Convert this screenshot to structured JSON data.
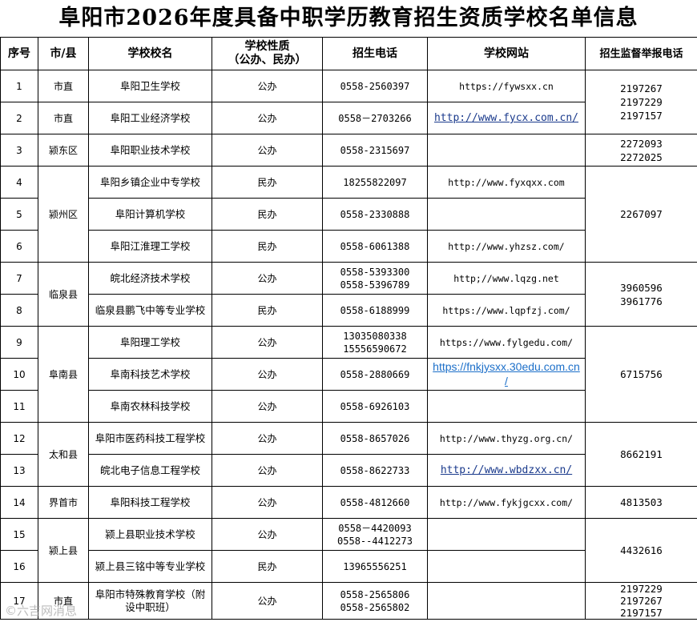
{
  "title": "阜阳市2026年度具备中职学历教育招生资质学校名单信息",
  "headers": {
    "seq": "序号",
    "city": "市/县",
    "school": "学校校名",
    "nature_line1": "学校性质",
    "nature_line2": "（公办、民办）",
    "phone": "招生电话",
    "website": "学校网站",
    "report": "招生监督举报电话"
  },
  "rows": [
    {
      "seq": "1",
      "city": "市直",
      "school": "阜阳卫生学校",
      "nature": "公办",
      "phone": "0558-2560397",
      "website": "https://fywsxx.cn"
    },
    {
      "seq": "2",
      "city": "市直",
      "school": "阜阳工业经济学校",
      "nature": "公办",
      "phone": "0558－2703266",
      "website": "http://www.fycx.com.cn/"
    },
    {
      "seq": "3",
      "city": "颍东区",
      "school": "阜阳职业技术学校",
      "nature": "公办",
      "phone": "0558-2315697",
      "website": ""
    },
    {
      "seq": "4",
      "city": "颍州区",
      "school": "阜阳乡镇企业中专学校",
      "nature": "民办",
      "phone": "18255822097",
      "website": "http://www.fyxqxx.com"
    },
    {
      "seq": "5",
      "city": "",
      "school": "阜阳计算机学校",
      "nature": "民办",
      "phone": "0558-2330888",
      "website": ""
    },
    {
      "seq": "6",
      "city": "",
      "school": "阜阳江淮理工学校",
      "nature": "民办",
      "phone": "0558-6061388",
      "website": "http://www.yhzsz.com/"
    },
    {
      "seq": "7",
      "city": "临泉县",
      "school": "皖北经济技术学校",
      "nature": "公办",
      "phone_line1": "0558-5393300",
      "phone_line2": "0558-5396789",
      "website": "http;//www.lqzg.net"
    },
    {
      "seq": "8",
      "city": "",
      "school": "临泉县鹏飞中等专业学校",
      "nature": "民办",
      "phone": "0558-6188999",
      "website": "https://www.lqpfzj.com/"
    },
    {
      "seq": "9",
      "city": "阜南县",
      "school": "阜阳理工学校",
      "nature": "公办",
      "phone_line1": "13035080338",
      "phone_line2": "15556590672",
      "website": "https://www.fylgedu.com/"
    },
    {
      "seq": "10",
      "city": "",
      "school": "阜南科技艺术学校",
      "nature": "公办",
      "phone": "0558-2880669",
      "website_line1": "https://fnkjysxx.30edu.com.cn",
      "website_line2": "/"
    },
    {
      "seq": "11",
      "city": "",
      "school": "阜南农林科技学校",
      "nature": "公办",
      "phone": "0558-6926103",
      "website": ""
    },
    {
      "seq": "12",
      "city": "太和县",
      "school": "阜阳市医药科技工程学校",
      "nature": "公办",
      "phone": "0558-8657026",
      "website": "http://www.thyzg.org.cn/"
    },
    {
      "seq": "13",
      "city": "",
      "school": "皖北电子信息工程学校",
      "nature": "公办",
      "phone": "0558-8622733",
      "website": "http://www.wbdzxx.cn/"
    },
    {
      "seq": "14",
      "city": "界首市",
      "school": "阜阳科技工程学校",
      "nature": "公办",
      "phone": "0558-4812660",
      "website": "http://www.fykjgcxx.com/"
    },
    {
      "seq": "15",
      "city": "颍上县",
      "school": "颍上县职业技术学校",
      "nature": "公办",
      "phone_line1": "0558－4420093",
      "phone_line2": "0558--4412273",
      "website": ""
    },
    {
      "seq": "16",
      "city": "",
      "school": "颍上县三铭中等专业学校",
      "nature": "民办",
      "phone": "13965556251",
      "website": ""
    },
    {
      "seq": "17",
      "city": "市直",
      "school_line1": "阜阳市特殊教育学校（附",
      "school_line2": "设中职班）",
      "nature": "公办",
      "phone_line1": "0558-2565806",
      "phone_line2": "0558-2565802",
      "website": ""
    }
  ],
  "report_phones": {
    "g1": [
      "2197267",
      "2197229",
      "2197157"
    ],
    "g2": [
      "2272093",
      "2272025"
    ],
    "g3": [
      "2267097"
    ],
    "g4": [
      "3960596",
      "3961776"
    ],
    "g5": [
      "6715756"
    ],
    "g6": [
      "8662191"
    ],
    "g7": [
      "4813503"
    ],
    "g8": [
      "4432616"
    ],
    "g9": [
      "2197229",
      "2197267",
      "2197157"
    ]
  },
  "watermark": "©六吉网消息"
}
